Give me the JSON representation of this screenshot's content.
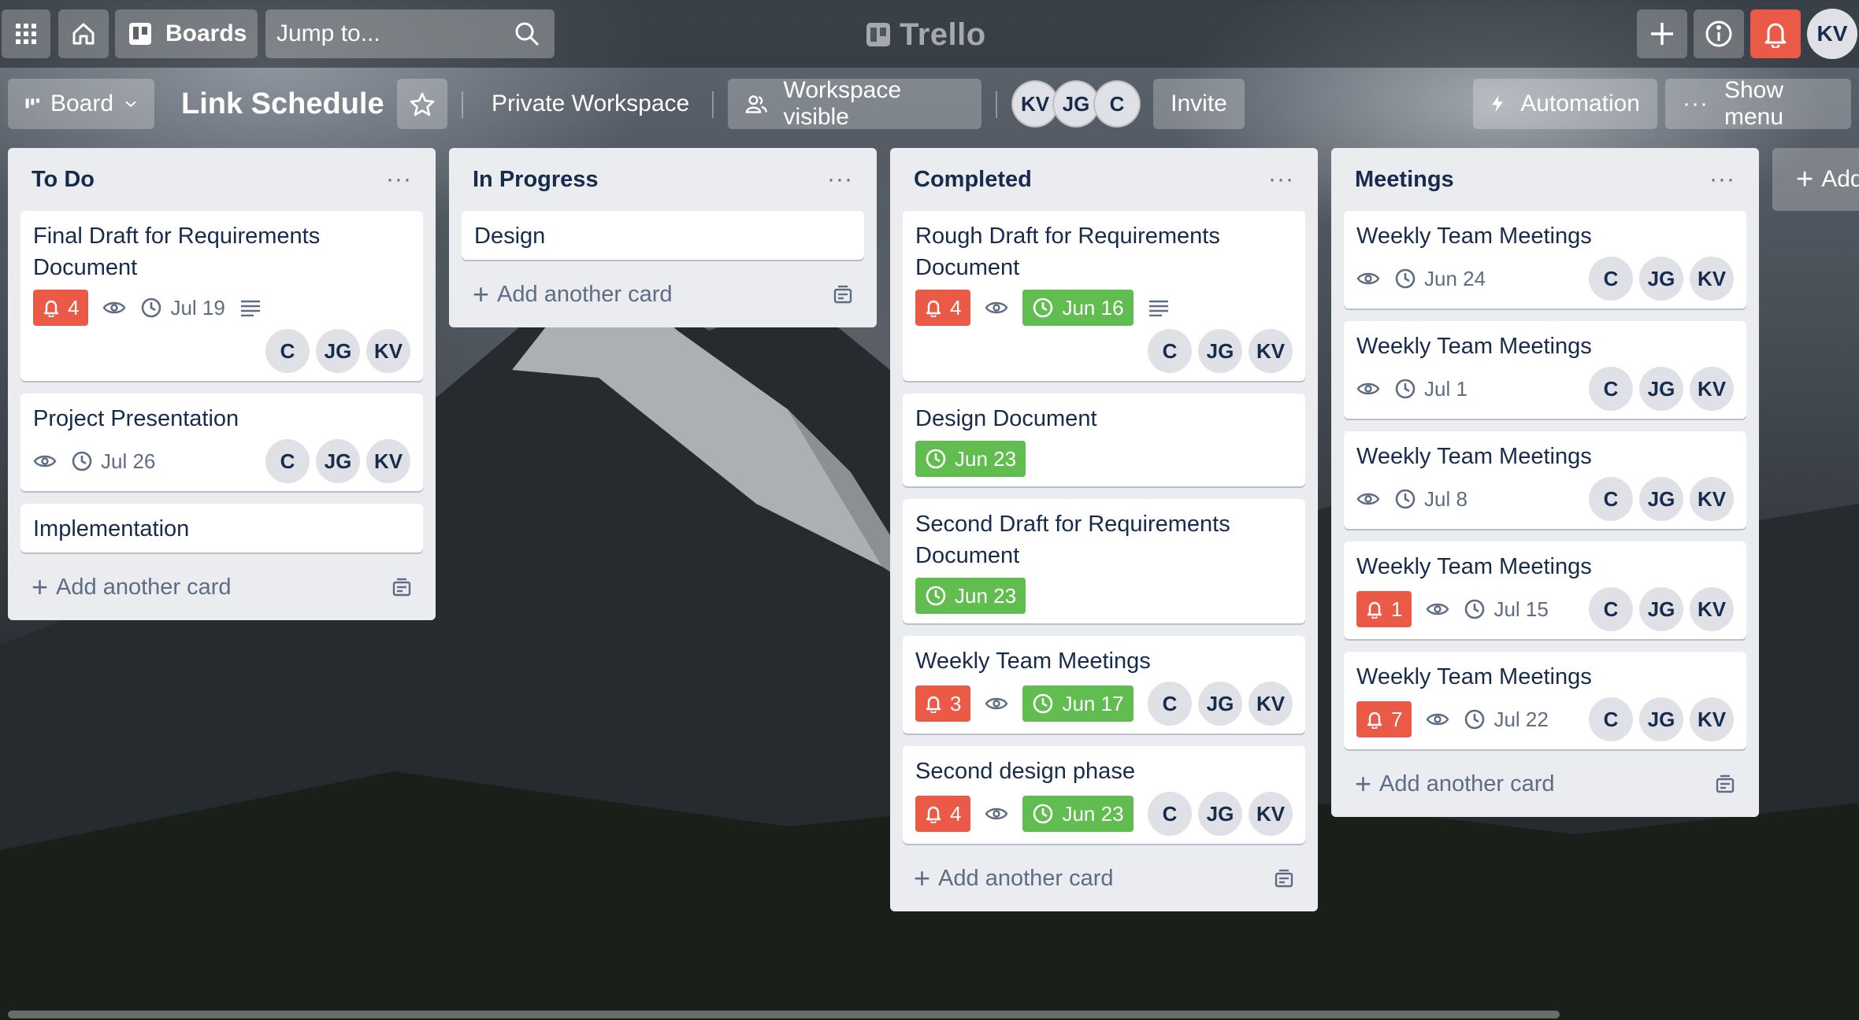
{
  "topbar": {
    "boards_label": "Boards",
    "search_placeholder": "Jump to...",
    "brand": "Trello",
    "user_initials": "KV"
  },
  "board": {
    "view_label": "Board",
    "title": "Link Schedule",
    "workspace": "Private Workspace",
    "visibility": "Workspace visible",
    "members": [
      "KV",
      "JG",
      "C"
    ],
    "invite_label": "Invite",
    "automation_label": "Automation",
    "show_menu_label": "Show menu",
    "add_list_label": "Add"
  },
  "colors": {
    "alert": "#eb5a46",
    "done": "#61bd4f",
    "list_bg": "#ebecf0"
  },
  "lists": [
    {
      "title": "To Do",
      "add_card_label": "Add another card",
      "cards": [
        {
          "title": "Final Draft for Requirements Document",
          "alerts": "4",
          "watch": true,
          "date": "Jul 19",
          "date_done": false,
          "description": true,
          "members": [
            "C",
            "JG",
            "KV"
          ],
          "members_inline": false
        },
        {
          "title": "Project Presentation",
          "alerts": null,
          "watch": true,
          "date": "Jul 26",
          "date_done": false,
          "description": false,
          "members": [
            "C",
            "JG",
            "KV"
          ],
          "members_inline": true
        },
        {
          "title": "Implementation",
          "alerts": null,
          "watch": false,
          "date": null,
          "date_done": false,
          "description": false,
          "members": [],
          "members_inline": true
        }
      ]
    },
    {
      "title": "In Progress",
      "add_card_label": "Add another card",
      "cards": [
        {
          "title": "Design",
          "alerts": null,
          "watch": false,
          "date": null,
          "date_done": false,
          "description": false,
          "members": [],
          "members_inline": true
        }
      ]
    },
    {
      "title": "Completed",
      "add_card_label": "Add another card",
      "cards": [
        {
          "title": "Rough Draft for Requirements Document",
          "alerts": "4",
          "watch": true,
          "date": "Jun 16",
          "date_done": true,
          "description": true,
          "members": [
            "C",
            "JG",
            "KV"
          ],
          "members_inline": false
        },
        {
          "title": "Design Document",
          "alerts": null,
          "watch": false,
          "date": "Jun 23",
          "date_done": true,
          "description": false,
          "members": [],
          "members_inline": true
        },
        {
          "title": "Second Draft for Requirements Document",
          "alerts": null,
          "watch": false,
          "date": "Jun 23",
          "date_done": true,
          "description": false,
          "members": [],
          "members_inline": true
        },
        {
          "title": "Weekly Team Meetings",
          "alerts": "3",
          "watch": true,
          "date": "Jun 17",
          "date_done": true,
          "description": false,
          "members": [
            "C",
            "JG",
            "KV"
          ],
          "members_inline": true
        },
        {
          "title": "Second design phase",
          "alerts": "4",
          "watch": true,
          "date": "Jun 23",
          "date_done": true,
          "description": false,
          "members": [
            "C",
            "JG",
            "KV"
          ],
          "members_inline": true
        }
      ]
    },
    {
      "title": "Meetings",
      "add_card_label": "Add another card",
      "cards": [
        {
          "title": "Weekly Team Meetings",
          "alerts": null,
          "watch": true,
          "date": "Jun 24",
          "date_done": false,
          "description": false,
          "members": [
            "C",
            "JG",
            "KV"
          ],
          "members_inline": true
        },
        {
          "title": "Weekly Team Meetings",
          "alerts": null,
          "watch": true,
          "date": "Jul 1",
          "date_done": false,
          "description": false,
          "members": [
            "C",
            "JG",
            "KV"
          ],
          "members_inline": true
        },
        {
          "title": "Weekly Team Meetings",
          "alerts": null,
          "watch": true,
          "date": "Jul 8",
          "date_done": false,
          "description": false,
          "members": [
            "C",
            "JG",
            "KV"
          ],
          "members_inline": true
        },
        {
          "title": "Weekly Team Meetings",
          "alerts": "1",
          "watch": true,
          "date": "Jul 15",
          "date_done": false,
          "description": false,
          "members": [
            "C",
            "JG",
            "KV"
          ],
          "members_inline": true
        },
        {
          "title": "Weekly Team Meetings",
          "alerts": "7",
          "watch": true,
          "date": "Jul 22",
          "date_done": false,
          "description": false,
          "members": [
            "C",
            "JG",
            "KV"
          ],
          "members_inline": true
        }
      ]
    }
  ]
}
